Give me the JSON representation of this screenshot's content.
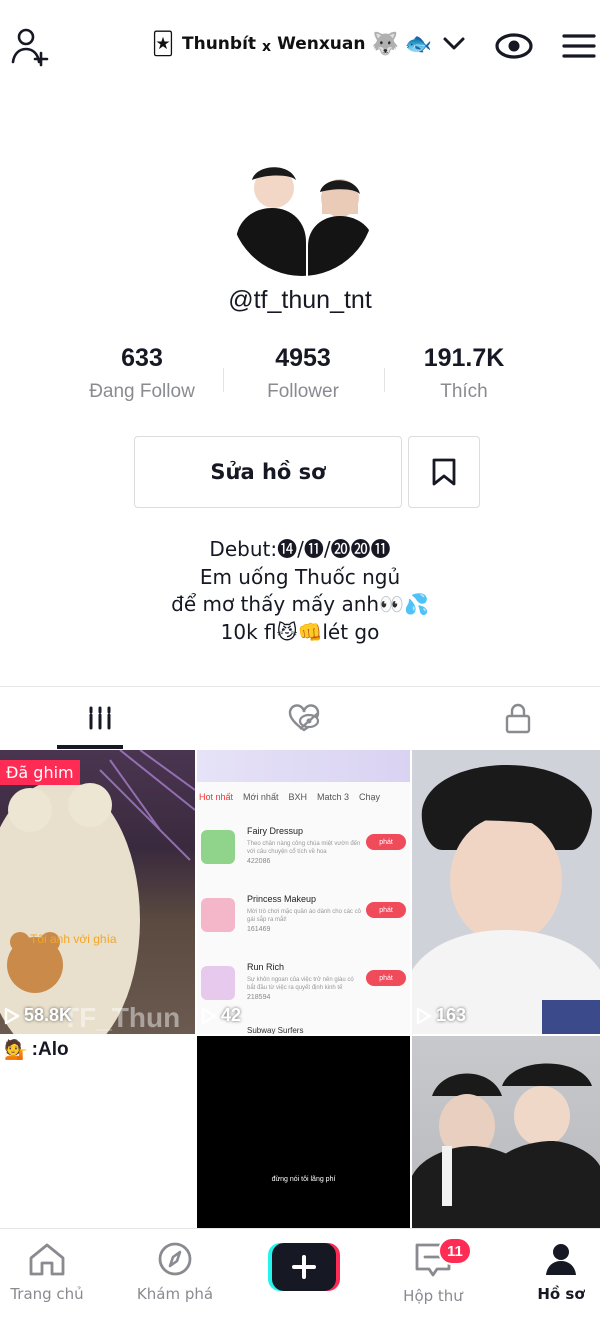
{
  "header": {
    "username_title": "Thunbít",
    "username_connector": "x",
    "username_title_2": "Wenxuan",
    "emoji_1": "🐺",
    "emoji_2": "🐟",
    "prefix_emoji": "🃏"
  },
  "profile": {
    "handle": "@tf_thun_tnt",
    "stats": [
      {
        "value": "633",
        "label": "Đang Follow"
      },
      {
        "value": "4953",
        "label": "Follower"
      },
      {
        "value": "191.7K",
        "label": "Thích"
      }
    ],
    "edit_button": "Sửa hồ sơ",
    "bio": [
      "Debut:⓮/⓫/⓴⓴⓫",
      "Em uống Thuốc ngủ",
      "để mơ thấy mấy anh👀💦",
      "10k fl😼👊lét go"
    ]
  },
  "tabs": [
    "videos",
    "liked",
    "private"
  ],
  "videos": [
    {
      "pinned_label": "Đã ghim",
      "views": "58.8K",
      "watermark": "TF_Thun",
      "overlay": "Tôi anh với ghía"
    },
    {
      "views": "42",
      "game_tabs": [
        "Hot nhất",
        "Mới nhất",
        "BXH",
        "Match 3",
        "Chạy"
      ],
      "games": [
        {
          "name": "Fairy Dressup",
          "desc": "Theo chân nàng công chúa miệt vườn đến với câu chuyện cổ tích về hoa",
          "count": "422086",
          "button": "phát"
        },
        {
          "name": "Princess Makeup",
          "desc": "Mời trò chơi mặc quần áo dành cho các cô gái sắp ra mắt!",
          "count": "161469",
          "button": "phát"
        },
        {
          "name": "Run Rich",
          "desc": "Sự khôn ngoan của việc trở nên giàu có bắt đầu từ việc ra quyết định kinh tế",
          "count": "218594",
          "button": "phát"
        }
      ],
      "footer": "Subway Surfers"
    },
    {
      "views": "163"
    },
    {
      "caption": ":Alo",
      "caption_emoji": "💁"
    },
    {
      "subtitle": "đừng nói tôi lãng phí"
    },
    {}
  ],
  "bottom_nav": {
    "home": "Trang chủ",
    "discover": "Khám phá",
    "inbox": "Hộp thư",
    "inbox_badge": "11",
    "me": "Hồ sơ"
  },
  "colors": {
    "accent": "#fe2c55",
    "text": "#161823",
    "muted": "#8a8b91",
    "create_cyan": "#25f4ee"
  }
}
